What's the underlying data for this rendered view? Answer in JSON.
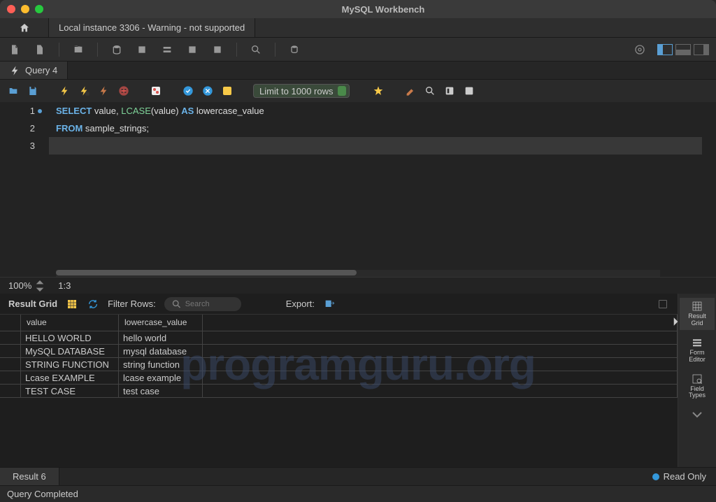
{
  "window": {
    "title": "MySQL Workbench"
  },
  "connection_tab": "Local instance 3306 - Warning - not supported",
  "query_tab": "Query 4",
  "limit_selector": "Limit to 1000 rows",
  "editor": {
    "lines": [
      {
        "n": "1",
        "dot": true,
        "tokens": [
          {
            "t": "SELECT",
            "c": "kw"
          },
          {
            "t": " value",
            "c": "id"
          },
          {
            "t": ", ",
            "c": "pn"
          },
          {
            "t": "LCASE",
            "c": "fn"
          },
          {
            "t": "(",
            "c": "pn"
          },
          {
            "t": "value",
            "c": "id"
          },
          {
            "t": ") ",
            "c": "pn"
          },
          {
            "t": "AS",
            "c": "kw"
          },
          {
            "t": " lowercase_value",
            "c": "id"
          }
        ]
      },
      {
        "n": "2",
        "dot": false,
        "tokens": [
          {
            "t": "FROM",
            "c": "kw"
          },
          {
            "t": " sample_strings",
            "c": "id"
          },
          {
            "t": ";",
            "c": "pn"
          }
        ]
      },
      {
        "n": "3",
        "dot": false,
        "tokens": []
      }
    ],
    "zoom": "100%",
    "pos": "1:3"
  },
  "result": {
    "header_label": "Result Grid",
    "filter_label": "Filter Rows:",
    "filter_placeholder": "Search",
    "export_label": "Export:",
    "columns": [
      "value",
      "lowercase_value"
    ],
    "rows": [
      [
        "HELLO WORLD",
        "hello world"
      ],
      [
        "MySQL DATABASE",
        "mysql database"
      ],
      [
        "STRING FUNCTION",
        "string function"
      ],
      [
        "Lcase EXAMPLE",
        "lcase example"
      ],
      [
        "TEST CASE",
        "test case"
      ]
    ],
    "sidebar": [
      {
        "label": "Result\nGrid",
        "active": true
      },
      {
        "label": "Form\nEditor",
        "active": false
      },
      {
        "label": "Field\nTypes",
        "active": false
      }
    ]
  },
  "bottom_tab": "Result 6",
  "readonly_label": "Read Only",
  "status": "Query Completed",
  "watermark": "programguru.org"
}
